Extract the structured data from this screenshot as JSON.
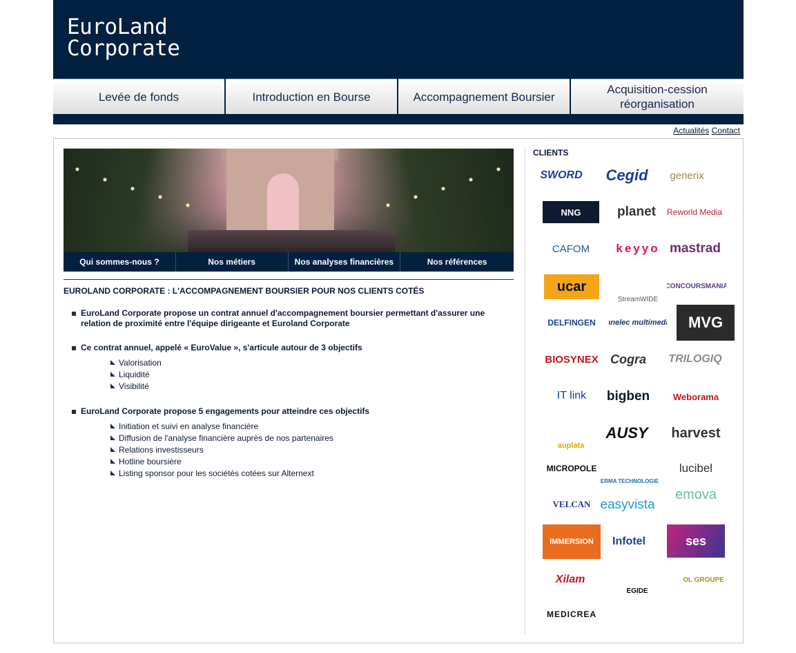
{
  "brand": {
    "line1": "EuroLand",
    "line2": "Corporate"
  },
  "topnav": {
    "tab1": "Levée de fonds",
    "tab2": "Introduction en Bourse",
    "tab3": "Accompagnement Boursier",
    "tab4_line1": "Acquisition-cession",
    "tab4_line2": "réorganisation"
  },
  "utility": {
    "news": "Actualités",
    "contact": "Contact"
  },
  "subnav": {
    "about": "Qui sommes-nous ?",
    "jobs": "Nos métiers",
    "analyses": "Nos analyses financières",
    "references": "Nos références"
  },
  "main": {
    "title": "EUROLAND CORPORATE : L'ACCOMPAGNEMENT BOURSIER POUR NOS CLIENTS COTÉS",
    "p1": "EuroLand Corporate propose un contrat annuel d'accompagnement boursier permettant d'assurer une relation de proximité entre l'équipe dirigeante et Euroland Corporate",
    "p2": "Ce contrat annuel, appelé « EuroValue », s'articule autour de 3 objectifs",
    "objectives": [
      "Valorisation",
      "Liquidité",
      "Visibilité"
    ],
    "p3": "EuroLand Corporate propose 5 engagements pour atteindre ces objectifs",
    "commitments": [
      "Initiation et suivi en analyse financière",
      "Diffusion de l'analyse financière auprès de nos partenaires",
      "Relations investisseurs",
      "Hotline boursière",
      "Listing sponsor pour les sociétés cotées sur Alternext"
    ]
  },
  "clients": {
    "title": "CLIENTS",
    "logos": [
      "SWORD",
      "Cegid",
      "generix",
      "NNG",
      "planet",
      "Reworld Media",
      "CAFOM",
      "keyyo",
      "mastrad",
      "ucar",
      "StreamWIDE",
      "CONCOURSMANIA",
      "DELFINGEN",
      "innelec multimedia",
      "MVG",
      "BIOSYNEX",
      "Cogra",
      "TRILOGIQ",
      "IT link",
      "bigben",
      "Weborama",
      "auplata",
      "AUSY",
      "harvest",
      "MICROPOLE",
      "SERMA TECHNOLOGIES",
      "lucibel",
      "VELCAN",
      "easyvista",
      "emova",
      "IMMERSION",
      "Infotel",
      "ses",
      "Xilam",
      "EGIDE",
      "OL GROUPE",
      "MEDICREA"
    ]
  },
  "colors": {
    "navy": "#02203f",
    "text": "#0c1a33"
  }
}
